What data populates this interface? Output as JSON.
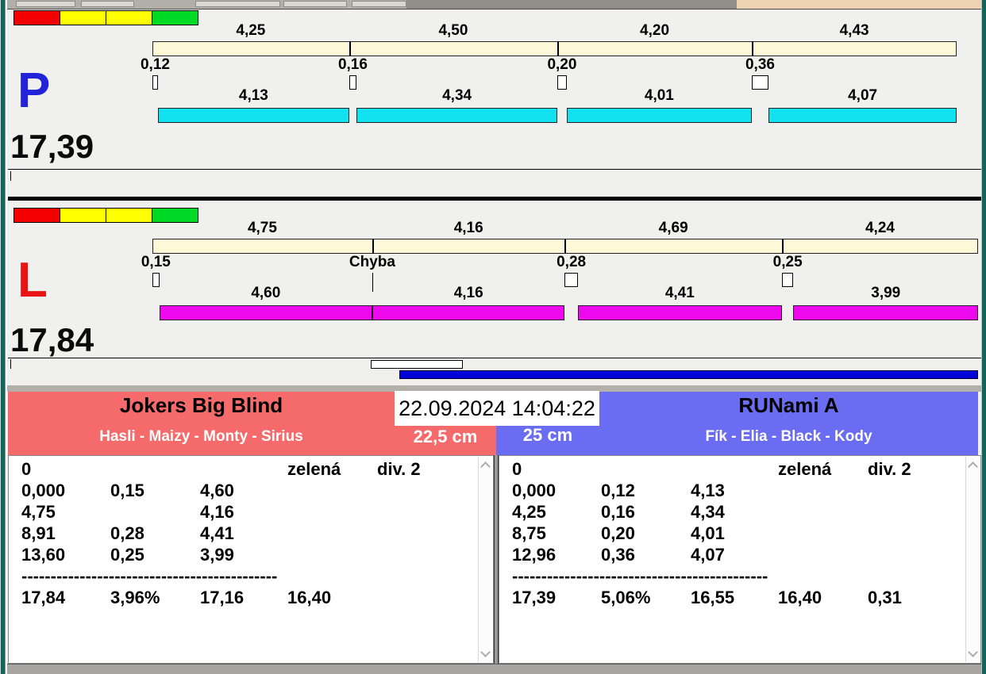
{
  "timestamp": "22.09.2024 14:04:22",
  "lanes": [
    {
      "letter": "P",
      "letter_color": "#2222d8",
      "total": "17,39",
      "run_color": "#12e2f0",
      "flags": [
        "#f40000",
        "#ffff00",
        "#ffff00",
        "#00d926"
      ],
      "segments": [
        {
          "split": "4,25",
          "change": "0,12",
          "run": "4,13"
        },
        {
          "split": "4,50",
          "change": "0,16",
          "run": "4,34"
        },
        {
          "split": "4,20",
          "change": "0,20",
          "run": "4,01"
        },
        {
          "split": "4,43",
          "change": "0,36",
          "run": "4,07"
        }
      ]
    },
    {
      "letter": "L",
      "letter_color": "#e81414",
      "total": "17,84",
      "run_color": "#ee08ee",
      "flags": [
        "#f40000",
        "#ffff00",
        "#ffff00",
        "#00d926"
      ],
      "segments": [
        {
          "split": "4,75",
          "change": "0,15",
          "run": "4,60"
        },
        {
          "split": "4,16",
          "change": "Chyba",
          "run": "4,16"
        },
        {
          "split": "4,69",
          "change": "0,28",
          "run": "4,41"
        },
        {
          "split": "4,24",
          "change": "0,25",
          "run": "3,99"
        }
      ]
    }
  ],
  "teams": [
    {
      "name": "Jokers Big Blind",
      "dogs": "Hasli - Maizy - Monty - Sirius",
      "jump_height": "22,5 cm",
      "color": "#f56a6b",
      "table_rows": [
        [
          "0",
          "",
          "",
          "zelená",
          "div. 2"
        ],
        [
          "0,000",
          "0,15",
          "4,60",
          "",
          ""
        ],
        [
          "4,75",
          "",
          "4,16",
          "",
          ""
        ],
        [
          "8,91",
          "0,28",
          "4,41",
          "",
          ""
        ],
        [
          "13,60",
          "0,25",
          "3,99",
          "",
          ""
        ],
        [
          "--------------------------------------------"
        ],
        [
          "17,84",
          "3,96%",
          "17,16",
          "16,40",
          ""
        ]
      ]
    },
    {
      "name": "RUNami A",
      "dogs": "Fík - Elia - Black - Kody",
      "jump_height": "25 cm",
      "color": "#6a6cf2",
      "table_rows": [
        [
          "0",
          "",
          "",
          "zelená",
          "div. 2"
        ],
        [
          "0,000",
          "0,12",
          "4,13",
          "",
          ""
        ],
        [
          "4,25",
          "0,16",
          "4,34",
          "",
          ""
        ],
        [
          "8,75",
          "0,20",
          "4,01",
          "",
          ""
        ],
        [
          "12,96",
          "0,36",
          "4,07",
          "",
          ""
        ],
        [
          "--------------------------------------------"
        ],
        [
          "17,39",
          "5,06%",
          "16,55",
          "16,40",
          "0,31"
        ]
      ]
    }
  ]
}
